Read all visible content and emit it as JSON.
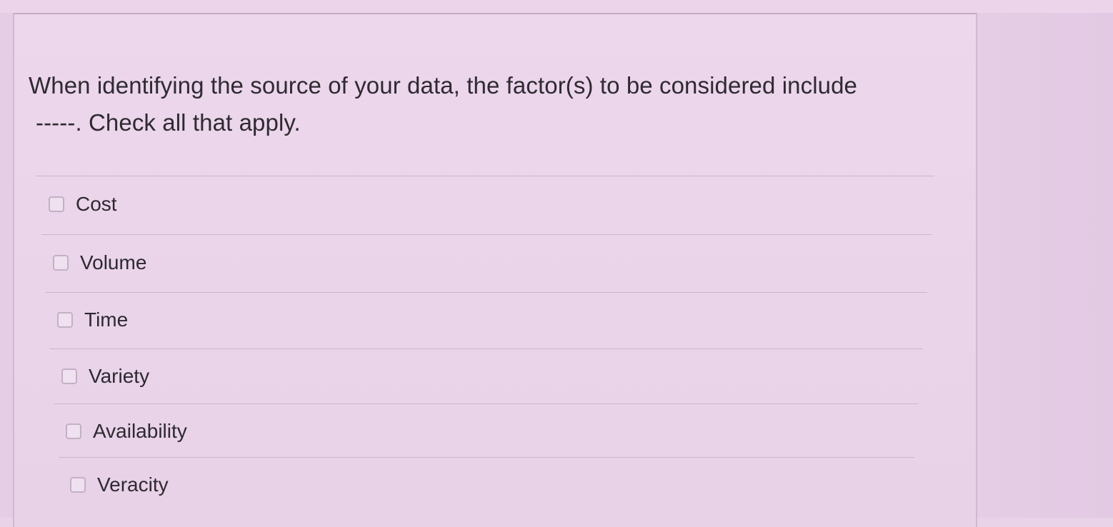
{
  "question": {
    "text_line1": "When identifying the source of your data, the factor(s) to be considered include",
    "blank": "-----",
    "text_line2": ". Check all that apply."
  },
  "options": [
    {
      "label": "Cost",
      "checked": false
    },
    {
      "label": "Volume",
      "checked": false
    },
    {
      "label": "Time",
      "checked": false
    },
    {
      "label": "Variety",
      "checked": false
    },
    {
      "label": "Availability",
      "checked": false
    },
    {
      "label": "Veracity",
      "checked": false
    }
  ]
}
